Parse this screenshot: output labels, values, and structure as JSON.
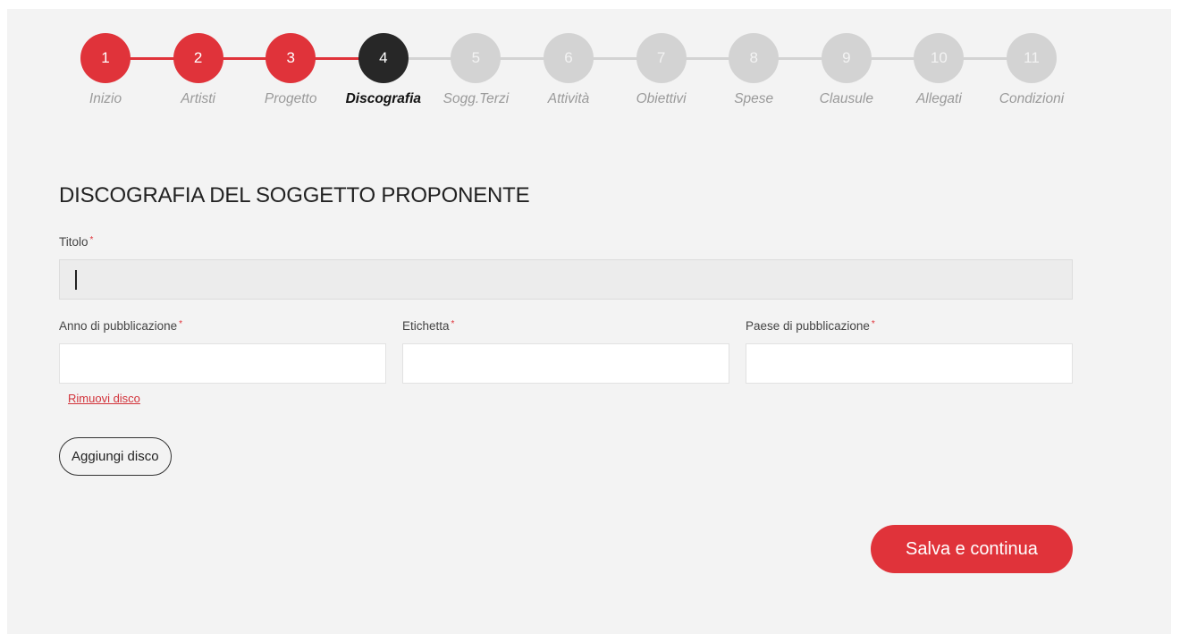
{
  "stepper": {
    "steps": [
      {
        "number": "1",
        "label": "Inizio",
        "state": "done"
      },
      {
        "number": "2",
        "label": "Artisti",
        "state": "done"
      },
      {
        "number": "3",
        "label": "Progetto",
        "state": "done"
      },
      {
        "number": "4",
        "label": "Discografia",
        "state": "current"
      },
      {
        "number": "5",
        "label": "Sogg.Terzi",
        "state": "todo"
      },
      {
        "number": "6",
        "label": "Attività",
        "state": "todo"
      },
      {
        "number": "7",
        "label": "Obiettivi",
        "state": "todo"
      },
      {
        "number": "8",
        "label": "Spese",
        "state": "todo"
      },
      {
        "number": "9",
        "label": "Clausule",
        "state": "todo"
      },
      {
        "number": "10",
        "label": "Allegati",
        "state": "todo"
      },
      {
        "number": "11",
        "label": "Condizioni",
        "state": "todo"
      }
    ]
  },
  "section": {
    "title": "DISCOGRAFIA DEL SOGGETTO PROPONENTE"
  },
  "form": {
    "titolo": {
      "label": "Titolo",
      "required_mark": "*",
      "value": ""
    },
    "anno": {
      "label": "Anno di pubblicazione",
      "required_mark": "*",
      "value": ""
    },
    "etichetta": {
      "label": "Etichetta",
      "required_mark": "*",
      "value": ""
    },
    "paese": {
      "label": "Paese di pubblicazione",
      "required_mark": "*",
      "value": ""
    },
    "remove_link": "Rimuovi disco",
    "add_button": "Aggiungi disco",
    "save_button": "Salva e continua"
  },
  "colors": {
    "accent": "#e0333a",
    "current_step": "#272727",
    "todo_step": "#d3d3d3",
    "panel_bg": "#f3f3f3"
  }
}
